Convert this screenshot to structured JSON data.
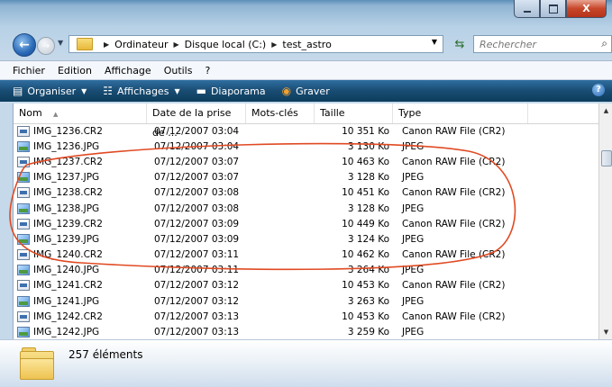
{
  "window": {
    "caption": {
      "minimize": "–",
      "maximize": "□",
      "close": "X"
    },
    "colors": {
      "accent": "#194c72",
      "annotation": "#e04a23"
    }
  },
  "address_bar": {
    "back_icon": "arrow-left-icon",
    "path": [
      "Ordinateur",
      "Disque local (C:)",
      "test_astro"
    ],
    "search_placeholder": "Rechercher"
  },
  "menubar": [
    "Fichier",
    "Edition",
    "Affichage",
    "Outils",
    "?"
  ],
  "commandbar": {
    "organize": "Organiser",
    "views": "Affichages",
    "slideshow": "Diaporama",
    "burn": "Graver"
  },
  "columns": {
    "name": "Nom",
    "date": "Date de la prise de ...",
    "tags": "Mots-clés",
    "size": "Taille",
    "type": "Type"
  },
  "files": [
    {
      "name": "IMG_1236.CR2",
      "date": "07/12/2007 03:04",
      "size": "10 351 Ko",
      "type": "Canon RAW File (CR2)",
      "icon": "raw"
    },
    {
      "name": "IMG_1236.JPG",
      "date": "07/12/2007 03:04",
      "size": "3 130 Ko",
      "type": "JPEG",
      "icon": "jpg"
    },
    {
      "name": "IMG_1237.CR2",
      "date": "07/12/2007 03:07",
      "size": "10 463 Ko",
      "type": "Canon RAW File (CR2)",
      "icon": "raw"
    },
    {
      "name": "IMG_1237.JPG",
      "date": "07/12/2007 03:07",
      "size": "3 128 Ko",
      "type": "JPEG",
      "icon": "jpg"
    },
    {
      "name": "IMG_1238.CR2",
      "date": "07/12/2007 03:08",
      "size": "10 451 Ko",
      "type": "Canon RAW File (CR2)",
      "icon": "raw"
    },
    {
      "name": "IMG_1238.JPG",
      "date": "07/12/2007 03:08",
      "size": "3 128 Ko",
      "type": "JPEG",
      "icon": "jpg"
    },
    {
      "name": "IMG_1239.CR2",
      "date": "07/12/2007 03:09",
      "size": "10 449 Ko",
      "type": "Canon RAW File (CR2)",
      "icon": "raw"
    },
    {
      "name": "IMG_1239.JPG",
      "date": "07/12/2007 03:09",
      "size": "3 124 Ko",
      "type": "JPEG",
      "icon": "jpg"
    },
    {
      "name": "IMG_1240.CR2",
      "date": "07/12/2007 03:11",
      "size": "10 462 Ko",
      "type": "Canon RAW File (CR2)",
      "icon": "raw"
    },
    {
      "name": "IMG_1240.JPG",
      "date": "07/12/2007 03:11",
      "size": "3 264 Ko",
      "type": "JPEG",
      "icon": "jpg"
    },
    {
      "name": "IMG_1241.CR2",
      "date": "07/12/2007 03:12",
      "size": "10 453 Ko",
      "type": "Canon RAW File (CR2)",
      "icon": "raw"
    },
    {
      "name": "IMG_1241.JPG",
      "date": "07/12/2007 03:12",
      "size": "3 263 Ko",
      "type": "JPEG",
      "icon": "jpg"
    },
    {
      "name": "IMG_1242.CR2",
      "date": "07/12/2007 03:13",
      "size": "10 453 Ko",
      "type": "Canon RAW File (CR2)",
      "icon": "raw"
    },
    {
      "name": "IMG_1242.JPG",
      "date": "07/12/2007 03:13",
      "size": "3 259 Ko",
      "type": "JPEG",
      "icon": "jpg"
    }
  ],
  "status": {
    "count": "257 éléments"
  }
}
